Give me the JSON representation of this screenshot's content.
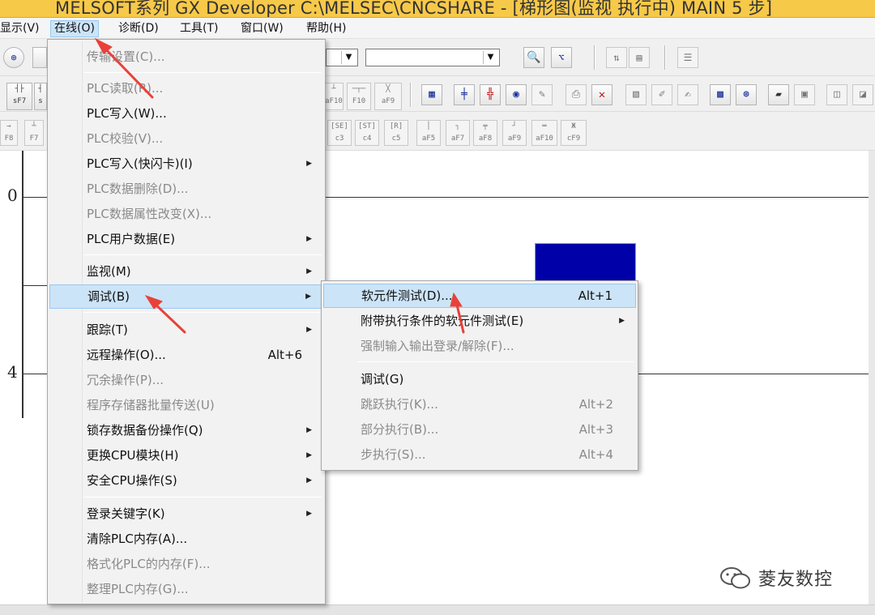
{
  "window": {
    "title": "MELSOFT系列 GX Developer C:\\MELSEC\\CNCSHARE - [梯形图(监视 执行中)      MAIN      5 步]"
  },
  "menubar": {
    "items": [
      "显示(V)",
      "在线(O)",
      "诊断(D)",
      "工具(T)",
      "窗口(W)",
      "帮助(H)"
    ],
    "active": "在线(O)"
  },
  "toolbar": {
    "fkeys_row2_left": [
      "sF7",
      "s"
    ],
    "fkeys_row2_right": [
      "aF10",
      "F10",
      "aF9"
    ],
    "fkeys_row3_left": [
      "F8",
      "F7"
    ],
    "fkeys_row3_right": [
      "c3",
      "c4",
      "c5",
      "aF5",
      "aF7",
      "aF8",
      "aF9",
      "aF10",
      "cF9"
    ],
    "row3_tags": [
      "[SE]",
      "[ST]",
      "[R]"
    ]
  },
  "ladder": {
    "steps": [
      "0",
      "4"
    ]
  },
  "online_menu": {
    "items": [
      {
        "label": "传输设置(C)...",
        "disabled": true
      },
      {
        "label": "PLC读取(R)...",
        "disabled": true
      },
      {
        "label": "PLC写入(W)...",
        "disabled": false
      },
      {
        "label": "PLC校验(V)...",
        "disabled": true
      },
      {
        "label": "PLC写入(快闪卡)(I)",
        "disabled": false,
        "submenu": true
      },
      {
        "label": "PLC数据删除(D)...",
        "disabled": true
      },
      {
        "label": "PLC数据属性改变(X)...",
        "disabled": true
      },
      {
        "label": "PLC用户数据(E)",
        "disabled": false,
        "submenu": true
      },
      {
        "label": "监视(M)",
        "disabled": false,
        "submenu": true
      },
      {
        "label": "调试(B)",
        "disabled": false,
        "submenu": true,
        "highlighted": true
      },
      {
        "label": "跟踪(T)",
        "disabled": false,
        "submenu": true
      },
      {
        "label": "远程操作(O)...",
        "disabled": false,
        "shortcut": "Alt+6"
      },
      {
        "label": "冗余操作(P)...",
        "disabled": true
      },
      {
        "label": "程序存储器批量传送(U)",
        "disabled": true
      },
      {
        "label": "锁存数据备份操作(Q)",
        "disabled": false,
        "submenu": true
      },
      {
        "label": "更换CPU模块(H)",
        "disabled": false,
        "submenu": true
      },
      {
        "label": "安全CPU操作(S)",
        "disabled": false,
        "submenu": true
      },
      {
        "label": "登录关键字(K)",
        "disabled": false,
        "submenu": true
      },
      {
        "label": "清除PLC内存(A)...",
        "disabled": false
      },
      {
        "label": "格式化PLC的内存(F)...",
        "disabled": true
      },
      {
        "label": "整理PLC内存(G)...",
        "disabled": true
      }
    ]
  },
  "debug_submenu": {
    "items": [
      {
        "label": "软元件测试(D)...",
        "shortcut": "Alt+1",
        "disabled": false,
        "highlighted": true
      },
      {
        "label": "附带执行条件的软元件测试(E)",
        "disabled": false,
        "submenu": true
      },
      {
        "label": "强制输入输出登录/解除(F)...",
        "disabled": true
      },
      {
        "label": "调试(G)",
        "disabled": false
      },
      {
        "label": "跳跃执行(K)...",
        "shortcut": "Alt+2",
        "disabled": true
      },
      {
        "label": "部分执行(B)...",
        "shortcut": "Alt+3",
        "disabled": true
      },
      {
        "label": "步执行(S)...",
        "shortcut": "Alt+4",
        "disabled": true
      }
    ]
  },
  "watermark": {
    "text": "菱友数控"
  },
  "colors": {
    "titlebar": "#f7c949",
    "highlight": "#cce4f7",
    "cursor_block": "#0000a8",
    "arrow": "#e8413a"
  }
}
